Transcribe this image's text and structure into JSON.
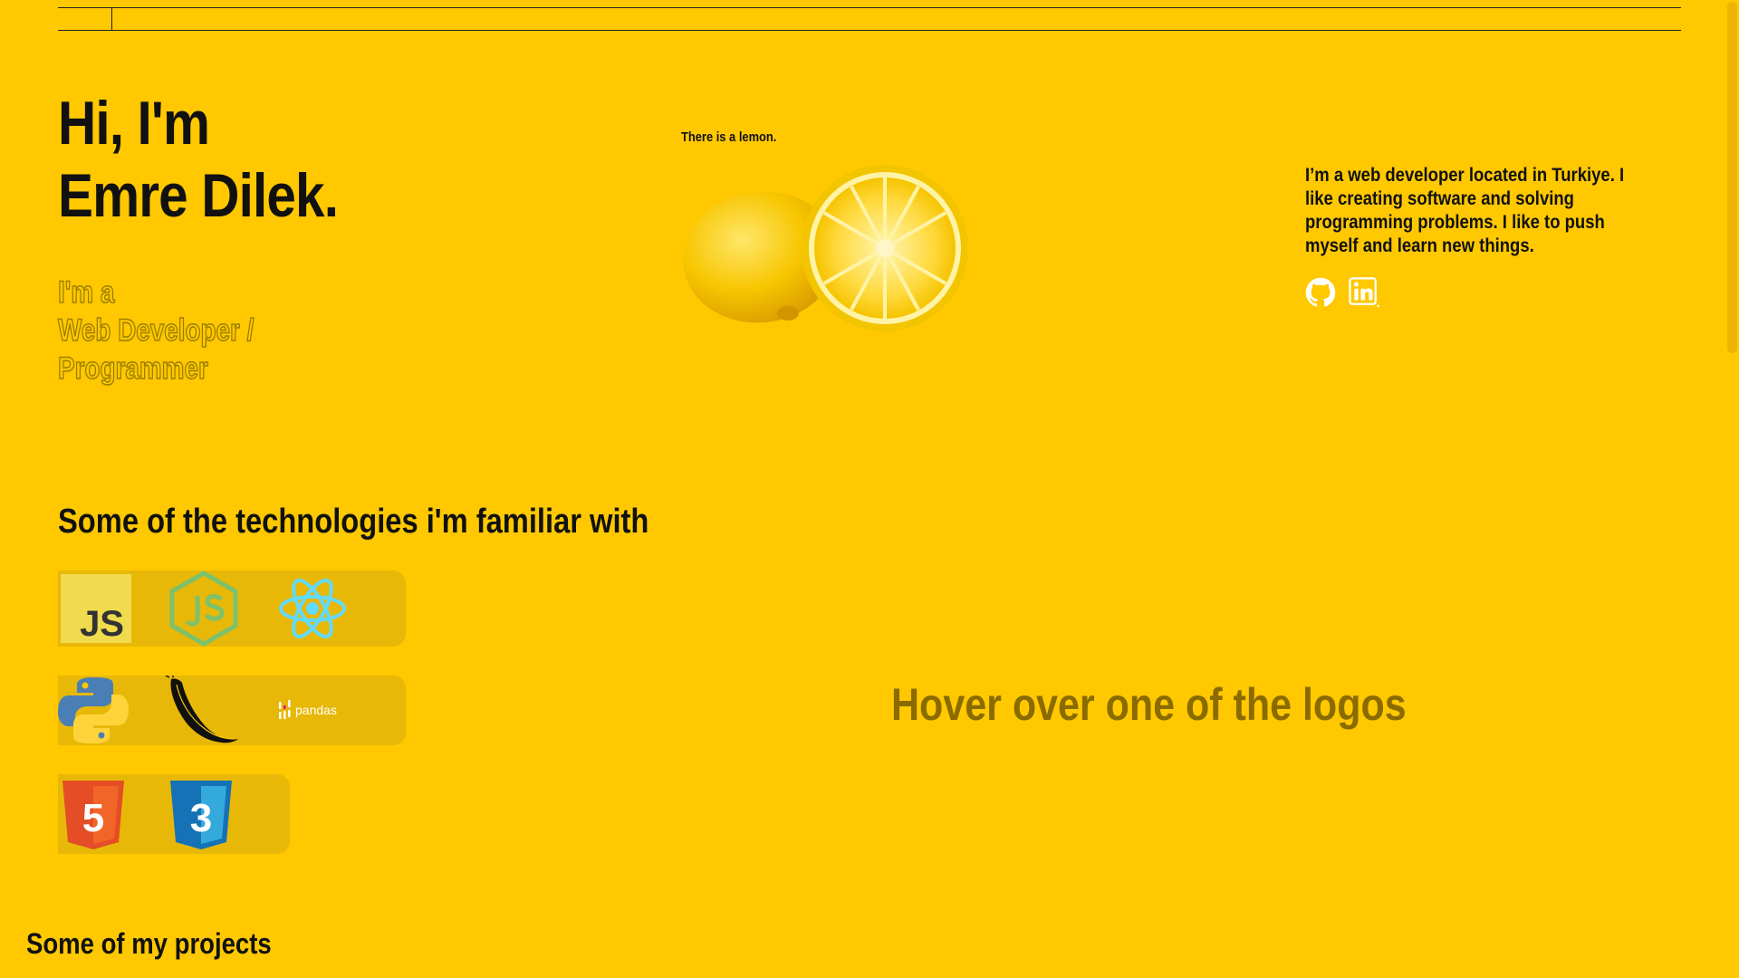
{
  "hero": {
    "greeting": "Hi, I'm",
    "name": "Emre Dilek."
  },
  "subtitle": {
    "line1": "I'm a",
    "line2": "Web Developer /",
    "line3": "Programmer"
  },
  "lemon": {
    "caption": "There is a lemon."
  },
  "about": {
    "text": "I’m a web developer located in Turkiye. I like creating software and solving programming problems. I like to push myself and learn new things."
  },
  "social": {
    "icons": [
      "github-icon",
      "linkedin-icon"
    ]
  },
  "technologies": {
    "heading": "Some of the technologies i'm familiar with",
    "rows": [
      [
        "javascript-logo",
        "nodejs-logo",
        "react-logo"
      ],
      [
        "python-logo",
        "flask-logo",
        "pandas-logo"
      ],
      [
        "html5-logo",
        "css3-logo"
      ]
    ],
    "js_label": "JS",
    "pandas_label": "pandas",
    "html_label": "5",
    "css_label": "3",
    "hover_hint": "Hover over one of the logos"
  },
  "projects": {
    "heading": "Some of my projects"
  },
  "colors": {
    "background": "#ffc800",
    "panel": "#e8b808",
    "text": "#111111",
    "muted": "#8a6b00"
  }
}
